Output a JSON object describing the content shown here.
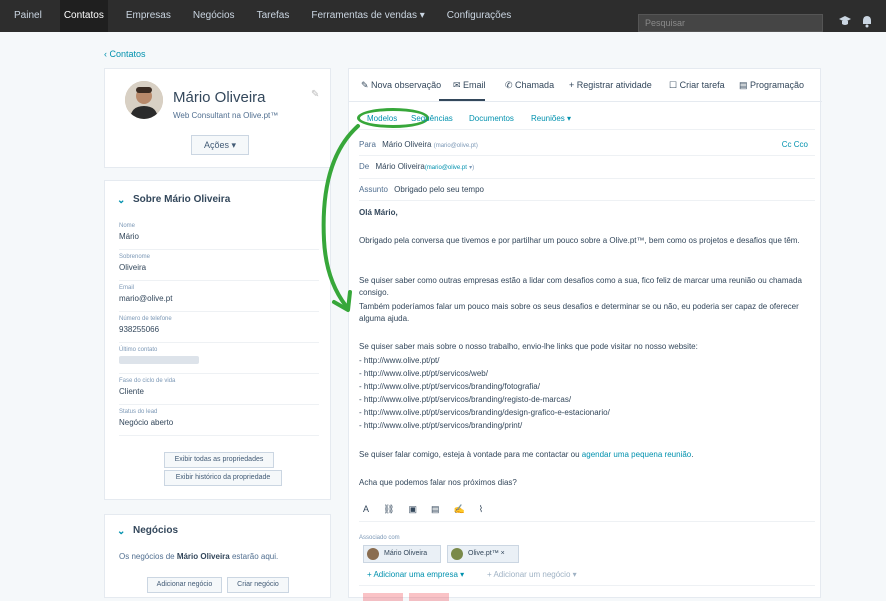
{
  "nav": {
    "items": [
      "Painel",
      "Contatos",
      "Empresas",
      "Negócios",
      "Tarefas",
      "Ferramentas de vendas ▾",
      "Configurações"
    ],
    "search_placeholder": "Pesquisar"
  },
  "back_link": "‹ Contatos",
  "contact": {
    "name": "Mário Oliveira",
    "subtitle": "Web Consultant na Olive.pt™",
    "actions_label": "Ações ▾"
  },
  "about": {
    "title": "Sobre Mário Oliveira",
    "props": [
      {
        "label": "Nome",
        "value": "Mário"
      },
      {
        "label": "Sobrenome",
        "value": "Oliveira"
      },
      {
        "label": "Email",
        "value": "mario@olive.pt"
      },
      {
        "label": "Número de telefone",
        "value": "938255066"
      },
      {
        "label": "Último contato",
        "value": ""
      },
      {
        "label": "Fase do ciclo de vida",
        "value": "Cliente"
      },
      {
        "label": "Status do lead",
        "value": "Negócio aberto"
      }
    ],
    "btn_all": "Exibir todas as propriedades",
    "btn_history": "Exibir histórico da propriedade"
  },
  "deals": {
    "title": "Negócios",
    "text_prefix": "Os negócios de ",
    "text_name": "Mário Oliveira",
    "text_suffix": " estarão aqui.",
    "btn_add": "Adicionar negócio",
    "btn_create": "Criar negócio"
  },
  "tabs": [
    "Nova observação",
    "Email",
    "Chamada",
    "Registrar atividade",
    "Criar tarefa",
    "Programação"
  ],
  "subtabs": [
    "Modelos",
    "Sequências",
    "Documentos",
    "Reuniões ▾"
  ],
  "email": {
    "to_label": "Para",
    "to_name": "Mário Oliveira",
    "to_email": "(mario@olive.pt)",
    "cc": "Cc  Cco",
    "from_label": "De",
    "from_name": "Mário Oliveira",
    "from_email": "(mario@olive.pt",
    "from_tail": "▾)",
    "subject_label": "Assunto",
    "subject": "Obrigado pelo seu tempo",
    "greeting": "Olá Mário,",
    "p1": "Obrigado pela conversa que tivemos e por  partilhar um pouco sobre a Olive.pt™, bem como os projetos e desafios que têm.",
    "p2a": "Se quiser saber como outras empresas estão a lidar com desafios como a sua, fico feliz de marcar uma reunião ou chamada consigo.",
    "p2b": "Também poderíamos falar um pouco mais sobre os seus desafios e determinar se ou não, eu poderia ser capaz de oferecer alguma ajuda.",
    "p3": "Se quiser saber mais sobre o nosso trabalho, envio-lhe links que pode visitar no nosso website:",
    "links": [
      "- http://www.olive.pt/pt/",
      "- http://www.olive.pt/pt/servicos/web/",
      "- http://www.olive.pt/pt/servicos/branding/fotografia/",
      "- http://www.olive.pt/pt/servicos/branding/registo-de-marcas/",
      "- http://www.olive.pt/pt/servicos/branding/design-grafico-e-estacionario/",
      "- http://www.olive.pt/pt/servicos/branding/print/"
    ],
    "p4_prefix": " Se quiser falar comigo, esteja à vontade para me contactar ou ",
    "p4_link": "agendar uma pequena reunião",
    "p4_suffix": ".",
    "p5": "Acha que podemos falar nos próximos dias?"
  },
  "assoc": {
    "label": "Associado com",
    "chip1": "Mário Oliveira",
    "chip2": "Olive.pt™  ×",
    "add_company": "+ Adicionar uma empresa ▾",
    "add_deal": "+ Adicionar um negócio ▾"
  }
}
